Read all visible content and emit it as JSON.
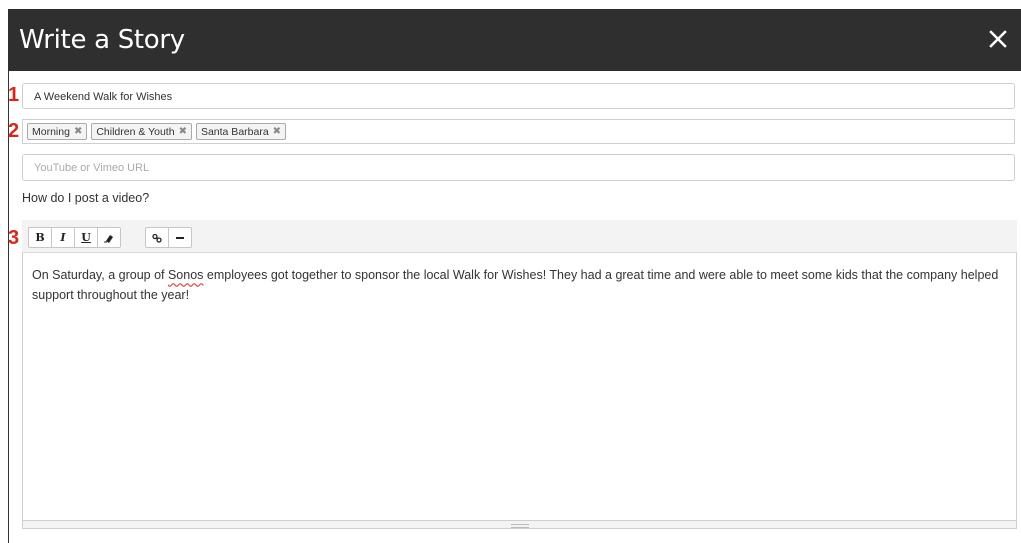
{
  "dialog": {
    "title": "Write a Story",
    "close_icon": "close-icon"
  },
  "markers": [
    "1",
    "2",
    "3"
  ],
  "story_title": {
    "value": "A Weekend Walk for Wishes"
  },
  "tags": [
    {
      "label": "Morning",
      "remove_icon": "remove-icon"
    },
    {
      "label": "Children & Youth",
      "remove_icon": "remove-icon"
    },
    {
      "label": "Santa Barbara",
      "remove_icon": "remove-icon"
    }
  ],
  "video": {
    "placeholder": "YouTube or Vimeo URL",
    "help_text": "How do I post a video?"
  },
  "toolbar": {
    "bold": "B",
    "italic": "I",
    "underline": "U",
    "clear_format_icon": "eraser-icon",
    "link_icon": "link-icon",
    "horizontal_rule_icon": "horizontal-rule-icon"
  },
  "editor": {
    "pre_text": "On Saturday, a group of ",
    "misspelled_word": "Sonos",
    "post_text": " employees got together to sponsor the local Walk for Wishes! They had a great time and were able to meet some kids that the company helped support throughout the year!"
  },
  "colors": {
    "header_bg": "#2f2f2f",
    "marker_red": "#d7261b",
    "spellcheck_underline": "#e05252"
  }
}
